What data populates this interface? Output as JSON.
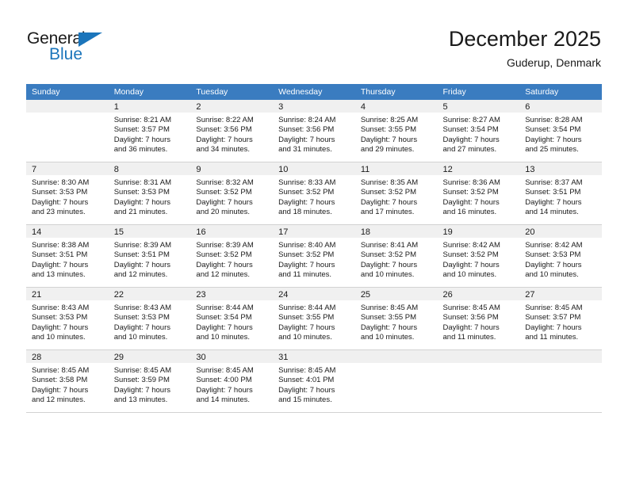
{
  "logo": {
    "word_one": "General",
    "word_two": "Blue",
    "triangle_color": "#1b75bb"
  },
  "header": {
    "title": "December 2025",
    "location": "Guderup, Denmark"
  },
  "theme": {
    "header_bg": "#3a7cc0",
    "daynum_bg": "#f0f0f0",
    "grid_line": "#d2d2d2",
    "text": "#1a1a1a"
  },
  "weekday_headers": [
    "Sunday",
    "Monday",
    "Tuesday",
    "Wednesday",
    "Thursday",
    "Friday",
    "Saturday"
  ],
  "weeks": [
    [
      {
        "day": "",
        "empty": true,
        "sunrise": "",
        "sunset": "",
        "daylight_line1": "",
        "daylight_line2": ""
      },
      {
        "day": "1",
        "empty": false,
        "sunrise": "Sunrise: 8:21 AM",
        "sunset": "Sunset: 3:57 PM",
        "daylight_line1": "Daylight: 7 hours",
        "daylight_line2": "and 36 minutes."
      },
      {
        "day": "2",
        "empty": false,
        "sunrise": "Sunrise: 8:22 AM",
        "sunset": "Sunset: 3:56 PM",
        "daylight_line1": "Daylight: 7 hours",
        "daylight_line2": "and 34 minutes."
      },
      {
        "day": "3",
        "empty": false,
        "sunrise": "Sunrise: 8:24 AM",
        "sunset": "Sunset: 3:56 PM",
        "daylight_line1": "Daylight: 7 hours",
        "daylight_line2": "and 31 minutes."
      },
      {
        "day": "4",
        "empty": false,
        "sunrise": "Sunrise: 8:25 AM",
        "sunset": "Sunset: 3:55 PM",
        "daylight_line1": "Daylight: 7 hours",
        "daylight_line2": "and 29 minutes."
      },
      {
        "day": "5",
        "empty": false,
        "sunrise": "Sunrise: 8:27 AM",
        "sunset": "Sunset: 3:54 PM",
        "daylight_line1": "Daylight: 7 hours",
        "daylight_line2": "and 27 minutes."
      },
      {
        "day": "6",
        "empty": false,
        "sunrise": "Sunrise: 8:28 AM",
        "sunset": "Sunset: 3:54 PM",
        "daylight_line1": "Daylight: 7 hours",
        "daylight_line2": "and 25 minutes."
      }
    ],
    [
      {
        "day": "7",
        "empty": false,
        "sunrise": "Sunrise: 8:30 AM",
        "sunset": "Sunset: 3:53 PM",
        "daylight_line1": "Daylight: 7 hours",
        "daylight_line2": "and 23 minutes."
      },
      {
        "day": "8",
        "empty": false,
        "sunrise": "Sunrise: 8:31 AM",
        "sunset": "Sunset: 3:53 PM",
        "daylight_line1": "Daylight: 7 hours",
        "daylight_line2": "and 21 minutes."
      },
      {
        "day": "9",
        "empty": false,
        "sunrise": "Sunrise: 8:32 AM",
        "sunset": "Sunset: 3:52 PM",
        "daylight_line1": "Daylight: 7 hours",
        "daylight_line2": "and 20 minutes."
      },
      {
        "day": "10",
        "empty": false,
        "sunrise": "Sunrise: 8:33 AM",
        "sunset": "Sunset: 3:52 PM",
        "daylight_line1": "Daylight: 7 hours",
        "daylight_line2": "and 18 minutes."
      },
      {
        "day": "11",
        "empty": false,
        "sunrise": "Sunrise: 8:35 AM",
        "sunset": "Sunset: 3:52 PM",
        "daylight_line1": "Daylight: 7 hours",
        "daylight_line2": "and 17 minutes."
      },
      {
        "day": "12",
        "empty": false,
        "sunrise": "Sunrise: 8:36 AM",
        "sunset": "Sunset: 3:52 PM",
        "daylight_line1": "Daylight: 7 hours",
        "daylight_line2": "and 16 minutes."
      },
      {
        "day": "13",
        "empty": false,
        "sunrise": "Sunrise: 8:37 AM",
        "sunset": "Sunset: 3:51 PM",
        "daylight_line1": "Daylight: 7 hours",
        "daylight_line2": "and 14 minutes."
      }
    ],
    [
      {
        "day": "14",
        "empty": false,
        "sunrise": "Sunrise: 8:38 AM",
        "sunset": "Sunset: 3:51 PM",
        "daylight_line1": "Daylight: 7 hours",
        "daylight_line2": "and 13 minutes."
      },
      {
        "day": "15",
        "empty": false,
        "sunrise": "Sunrise: 8:39 AM",
        "sunset": "Sunset: 3:51 PM",
        "daylight_line1": "Daylight: 7 hours",
        "daylight_line2": "and 12 minutes."
      },
      {
        "day": "16",
        "empty": false,
        "sunrise": "Sunrise: 8:39 AM",
        "sunset": "Sunset: 3:52 PM",
        "daylight_line1": "Daylight: 7 hours",
        "daylight_line2": "and 12 minutes."
      },
      {
        "day": "17",
        "empty": false,
        "sunrise": "Sunrise: 8:40 AM",
        "sunset": "Sunset: 3:52 PM",
        "daylight_line1": "Daylight: 7 hours",
        "daylight_line2": "and 11 minutes."
      },
      {
        "day": "18",
        "empty": false,
        "sunrise": "Sunrise: 8:41 AM",
        "sunset": "Sunset: 3:52 PM",
        "daylight_line1": "Daylight: 7 hours",
        "daylight_line2": "and 10 minutes."
      },
      {
        "day": "19",
        "empty": false,
        "sunrise": "Sunrise: 8:42 AM",
        "sunset": "Sunset: 3:52 PM",
        "daylight_line1": "Daylight: 7 hours",
        "daylight_line2": "and 10 minutes."
      },
      {
        "day": "20",
        "empty": false,
        "sunrise": "Sunrise: 8:42 AM",
        "sunset": "Sunset: 3:53 PM",
        "daylight_line1": "Daylight: 7 hours",
        "daylight_line2": "and 10 minutes."
      }
    ],
    [
      {
        "day": "21",
        "empty": false,
        "sunrise": "Sunrise: 8:43 AM",
        "sunset": "Sunset: 3:53 PM",
        "daylight_line1": "Daylight: 7 hours",
        "daylight_line2": "and 10 minutes."
      },
      {
        "day": "22",
        "empty": false,
        "sunrise": "Sunrise: 8:43 AM",
        "sunset": "Sunset: 3:53 PM",
        "daylight_line1": "Daylight: 7 hours",
        "daylight_line2": "and 10 minutes."
      },
      {
        "day": "23",
        "empty": false,
        "sunrise": "Sunrise: 8:44 AM",
        "sunset": "Sunset: 3:54 PM",
        "daylight_line1": "Daylight: 7 hours",
        "daylight_line2": "and 10 minutes."
      },
      {
        "day": "24",
        "empty": false,
        "sunrise": "Sunrise: 8:44 AM",
        "sunset": "Sunset: 3:55 PM",
        "daylight_line1": "Daylight: 7 hours",
        "daylight_line2": "and 10 minutes."
      },
      {
        "day": "25",
        "empty": false,
        "sunrise": "Sunrise: 8:45 AM",
        "sunset": "Sunset: 3:55 PM",
        "daylight_line1": "Daylight: 7 hours",
        "daylight_line2": "and 10 minutes."
      },
      {
        "day": "26",
        "empty": false,
        "sunrise": "Sunrise: 8:45 AM",
        "sunset": "Sunset: 3:56 PM",
        "daylight_line1": "Daylight: 7 hours",
        "daylight_line2": "and 11 minutes."
      },
      {
        "day": "27",
        "empty": false,
        "sunrise": "Sunrise: 8:45 AM",
        "sunset": "Sunset: 3:57 PM",
        "daylight_line1": "Daylight: 7 hours",
        "daylight_line2": "and 11 minutes."
      }
    ],
    [
      {
        "day": "28",
        "empty": false,
        "sunrise": "Sunrise: 8:45 AM",
        "sunset": "Sunset: 3:58 PM",
        "daylight_line1": "Daylight: 7 hours",
        "daylight_line2": "and 12 minutes."
      },
      {
        "day": "29",
        "empty": false,
        "sunrise": "Sunrise: 8:45 AM",
        "sunset": "Sunset: 3:59 PM",
        "daylight_line1": "Daylight: 7 hours",
        "daylight_line2": "and 13 minutes."
      },
      {
        "day": "30",
        "empty": false,
        "sunrise": "Sunrise: 8:45 AM",
        "sunset": "Sunset: 4:00 PM",
        "daylight_line1": "Daylight: 7 hours",
        "daylight_line2": "and 14 minutes."
      },
      {
        "day": "31",
        "empty": false,
        "sunrise": "Sunrise: 8:45 AM",
        "sunset": "Sunset: 4:01 PM",
        "daylight_line1": "Daylight: 7 hours",
        "daylight_line2": "and 15 minutes."
      },
      {
        "day": "",
        "empty": true,
        "sunrise": "",
        "sunset": "",
        "daylight_line1": "",
        "daylight_line2": ""
      },
      {
        "day": "",
        "empty": true,
        "sunrise": "",
        "sunset": "",
        "daylight_line1": "",
        "daylight_line2": ""
      },
      {
        "day": "",
        "empty": true,
        "sunrise": "",
        "sunset": "",
        "daylight_line1": "",
        "daylight_line2": ""
      }
    ]
  ]
}
